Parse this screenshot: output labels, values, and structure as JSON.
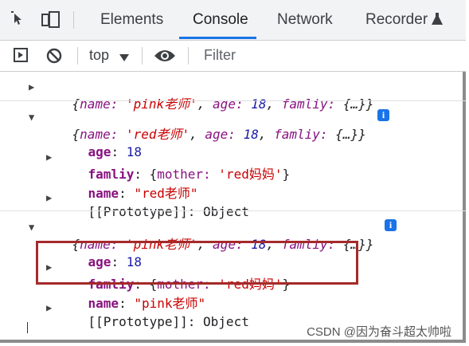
{
  "tabs": [
    {
      "label": "Elements",
      "active": false
    },
    {
      "label": "Console",
      "active": true
    },
    {
      "label": "Network",
      "active": false
    },
    {
      "label": "Recorder",
      "active": false
    }
  ],
  "toolbar": {
    "context": "top",
    "filter_placeholder": "Filter"
  },
  "logs": [
    {
      "preview": {
        "prefix": "{",
        "k1": "name: ",
        "v1": "'pink老师'",
        "s1": ", ",
        "k2": "age: ",
        "v2": "18",
        "s2": ", ",
        "k3": "famliy: ",
        "v3": "{…}",
        "suffix": "}"
      },
      "expanded": false
    },
    {
      "preview": {
        "prefix": "{",
        "k1": "name: ",
        "v1": "'red老师'",
        "s1": ", ",
        "k2": "age: ",
        "v2": "18",
        "s2": ", ",
        "k3": "famliy: ",
        "v3": "{…}",
        "suffix": "}"
      },
      "expanded": true,
      "props": {
        "age_key": "age",
        "age_val": "18",
        "family_key": "famliy",
        "family_val_open": "{",
        "family_val_key": "mother: ",
        "family_val_str": "'red妈妈'",
        "family_val_close": "}",
        "name_key": "name",
        "name_val": "\"red老师\"",
        "proto_key": "[[Prototype]]",
        "proto_val": "Object"
      }
    },
    {
      "preview": {
        "prefix": "{",
        "k1": "name: ",
        "v1": "'pink老师'",
        "s1": ", ",
        "k2": "age: ",
        "v2": "18",
        "s2": ", ",
        "k3": "famliy: ",
        "v3": "{…}",
        "suffix": "}"
      },
      "expanded": true,
      "props": {
        "age_key": "age",
        "age_val": "18",
        "family_key": "famliy",
        "family_val_open": "{",
        "family_val_key": "mother: ",
        "family_val_str": "'red妈妈'",
        "family_val_close": "}",
        "name_key": "name",
        "name_val": "\"pink老师\"",
        "proto_key": "[[Prototype]]",
        "proto_val": "Object"
      }
    }
  ],
  "colon": ": ",
  "info_icon": "i",
  "watermark": "CSDN @因为奋斗超太帅啦",
  "colors": {
    "highlight_box": "#a52a2a",
    "active_tab": "#1a73e8",
    "string": "#c80000",
    "number": "#1a1aa6",
    "key": "#881280"
  }
}
